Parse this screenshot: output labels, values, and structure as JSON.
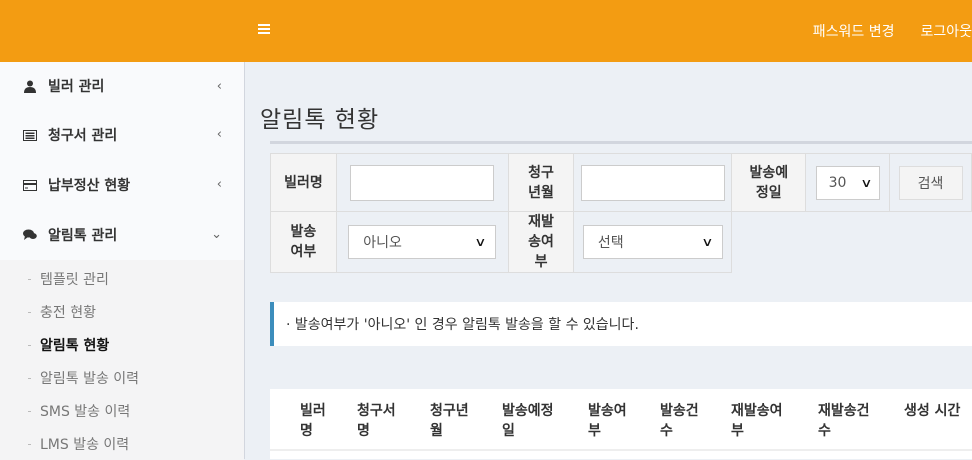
{
  "topbar": {
    "menu_toggle_icon": "hamburger-icon",
    "password_change": "패스워드 변경",
    "logout": "로그아웃"
  },
  "sidebar": {
    "items": [
      {
        "label": "빌러 관리",
        "icon": "user-icon",
        "chevron": "‹"
      },
      {
        "label": "청구서 관리",
        "icon": "list-icon",
        "chevron": "‹"
      },
      {
        "label": "납부정산 현황",
        "icon": "card-icon",
        "chevron": "‹"
      },
      {
        "label": "알림톡 관리",
        "icon": "comments-icon",
        "chevron": "⌄"
      }
    ],
    "submenu": [
      {
        "label": "템플릿 관리"
      },
      {
        "label": "충전 현황"
      },
      {
        "label": "알림톡 현황"
      },
      {
        "label": "알림톡 발송 이력"
      },
      {
        "label": "SMS 발송 이력"
      },
      {
        "label": "LMS 발송 이력"
      }
    ]
  },
  "page": {
    "title": "알림톡 현황"
  },
  "search": {
    "biller_label": "빌러명",
    "biller_value": "",
    "month_label": "청구년월",
    "month_value": "",
    "schedule_label": "발송예정일",
    "schedule_value": "30",
    "search_button": "검색",
    "sent_label": "발송여부",
    "sent_value": "아니오",
    "resend_label": "재발송여부",
    "resend_value": "선택"
  },
  "notice": "· 발송여부가 '아니오' 인 경우 알림톡 발송을 할 수 있습니다.",
  "table": {
    "columns": [
      "빌러명",
      "청구서명",
      "청구년월",
      "발송예정일",
      "발송여부",
      "발송건수",
      "재발송여부",
      "재발송건수",
      "생성 시간"
    ]
  },
  "colors": {
    "accent": "#f39c12",
    "info_border": "#3c8dbc"
  }
}
